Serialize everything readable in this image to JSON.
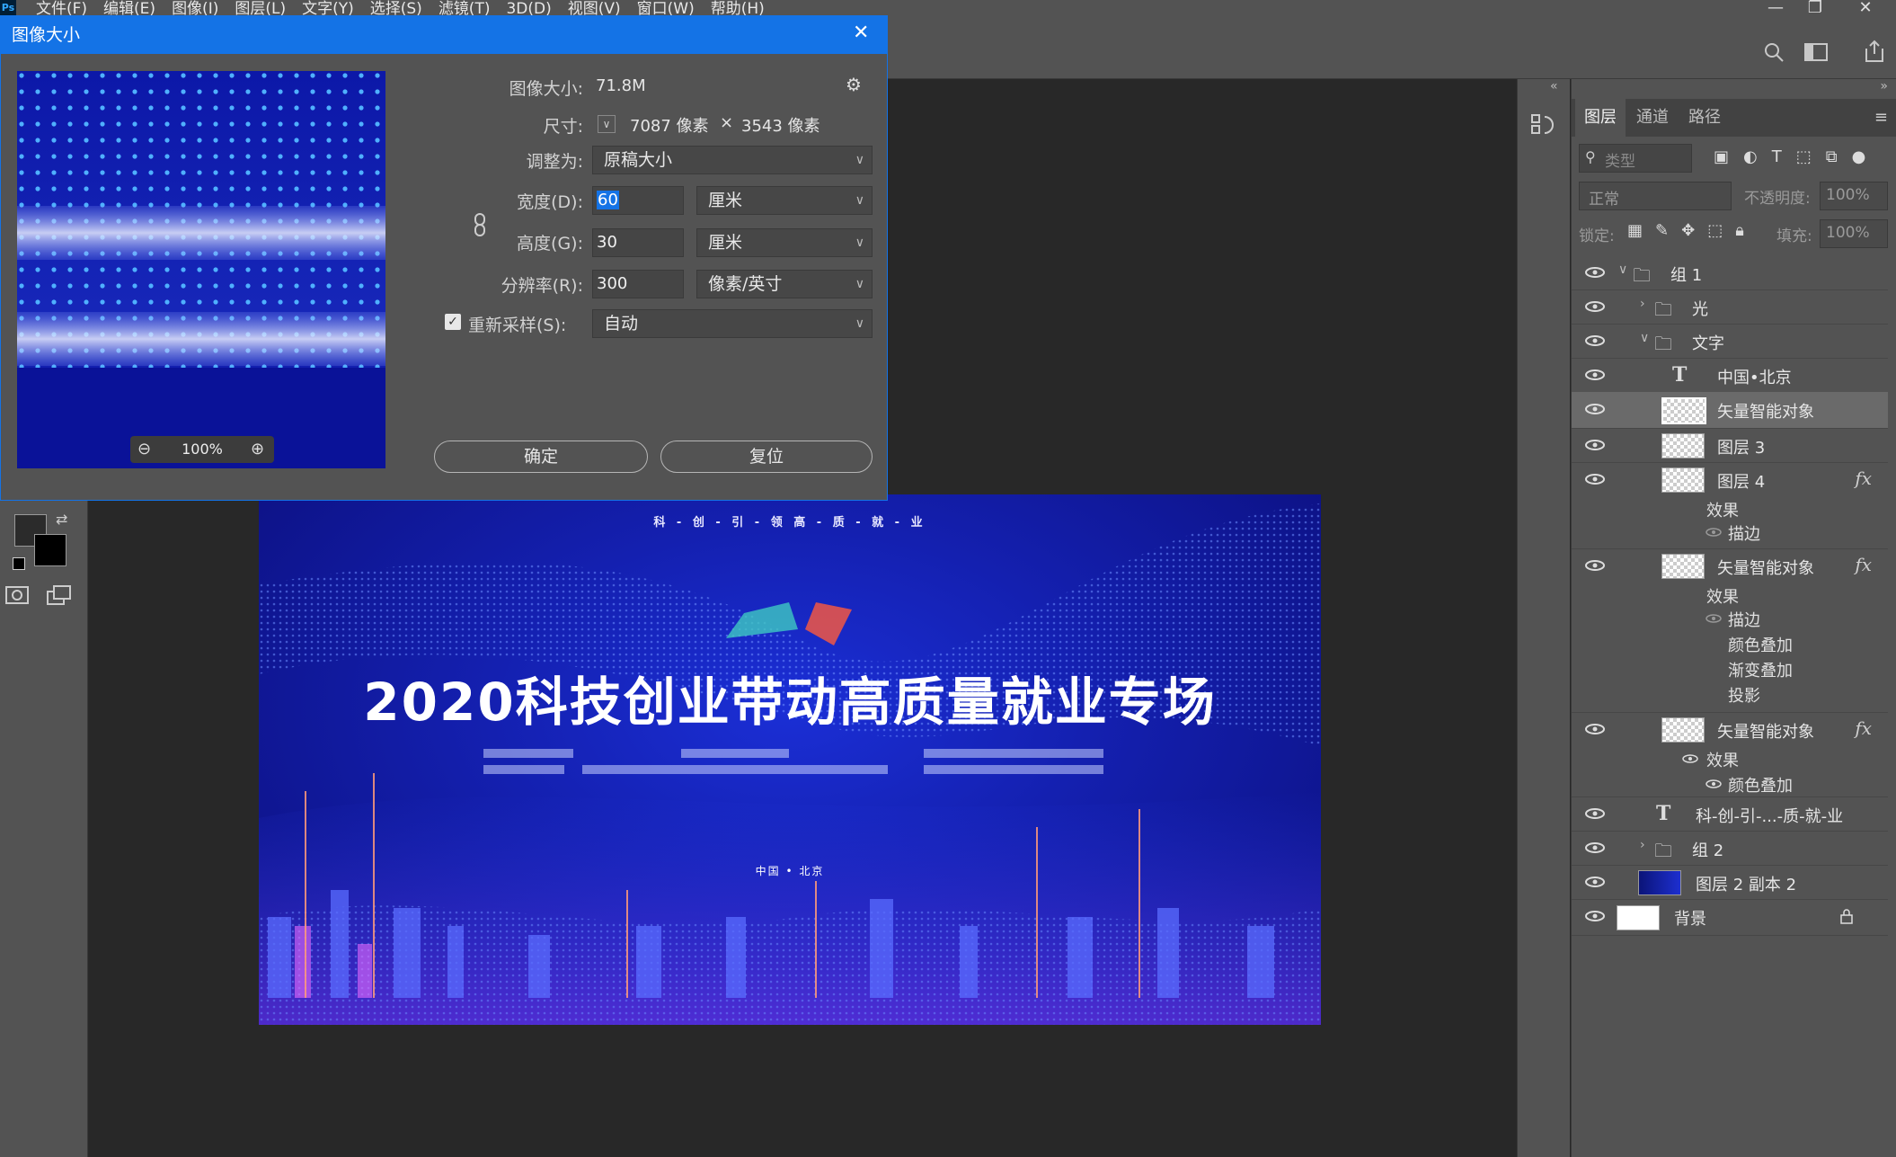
{
  "app": {
    "logo": "Ps"
  },
  "menu": [
    "文件(F)",
    "编辑(E)",
    "图像(I)",
    "图层(L)",
    "文字(Y)",
    "选择(S)",
    "滤镜(T)",
    "3D(D)",
    "视图(V)",
    "窗口(W)",
    "帮助(H)"
  ],
  "dialog": {
    "title": "图像大小",
    "image_size_label": "图像大小:",
    "image_size_value": "71.8M",
    "dimensions_label": "尺寸:",
    "dim_w": "7087 像素",
    "dim_x": "×",
    "dim_h": "3543 像素",
    "fit_label": "调整为:",
    "fit_value": "原稿大小",
    "width_label": "宽度(D):",
    "width_value": "60",
    "width_unit": "厘米",
    "height_label": "高度(G):",
    "height_value": "30",
    "height_unit": "厘米",
    "res_label": "分辨率(R):",
    "res_value": "300",
    "res_unit": "像素/英寸",
    "resample_label": "重新采样(S):",
    "resample_value": "自动",
    "resample_checked": true,
    "zoom": "100%",
    "ok": "确定",
    "reset": "复位"
  },
  "artwork": {
    "tagline": "科 - 创 - 引 - 领        高 - 质 - 就 - 业",
    "headline": "2020科技创业带动高质量就业专场",
    "location": "中国 • 北京"
  },
  "layers_panel": {
    "tabs": [
      "图层",
      "通道",
      "路径"
    ],
    "search_placeholder": "类型",
    "blend_mode": "正常",
    "opacity_label": "不透明度:",
    "opacity_value": "100%",
    "lock_label": "锁定:",
    "fill_label": "填充:",
    "fill_value": "100%",
    "layers": [
      {
        "name": "组 1"
      },
      {
        "name": "光"
      },
      {
        "name": "文字"
      },
      {
        "name": "中国•北京"
      },
      {
        "name": "矢量智能对象"
      },
      {
        "name": "图层 3"
      },
      {
        "name": "图层 4",
        "fx": "fx",
        "effects_label": "效果",
        "effects": [
          "描边"
        ]
      },
      {
        "name": "矢量智能对象",
        "fx": "fx",
        "effects_label": "效果",
        "effects": [
          "描边",
          "颜色叠加",
          "渐变叠加",
          "投影"
        ]
      },
      {
        "name": "矢量智能对象",
        "fx": "fx",
        "effects_label": "效果",
        "effects": [
          "颜色叠加"
        ]
      },
      {
        "name": "科-创-引-...-质-就-业"
      },
      {
        "name": "组 2"
      },
      {
        "name": "图层 2 副本 2"
      },
      {
        "name": "背景"
      }
    ]
  },
  "icons": {
    "eye": "eye-icon",
    "folder": "folder-icon",
    "text": "T",
    "lock": "lock-icon",
    "link": "chain-link-icon",
    "gear": "gear-icon"
  }
}
